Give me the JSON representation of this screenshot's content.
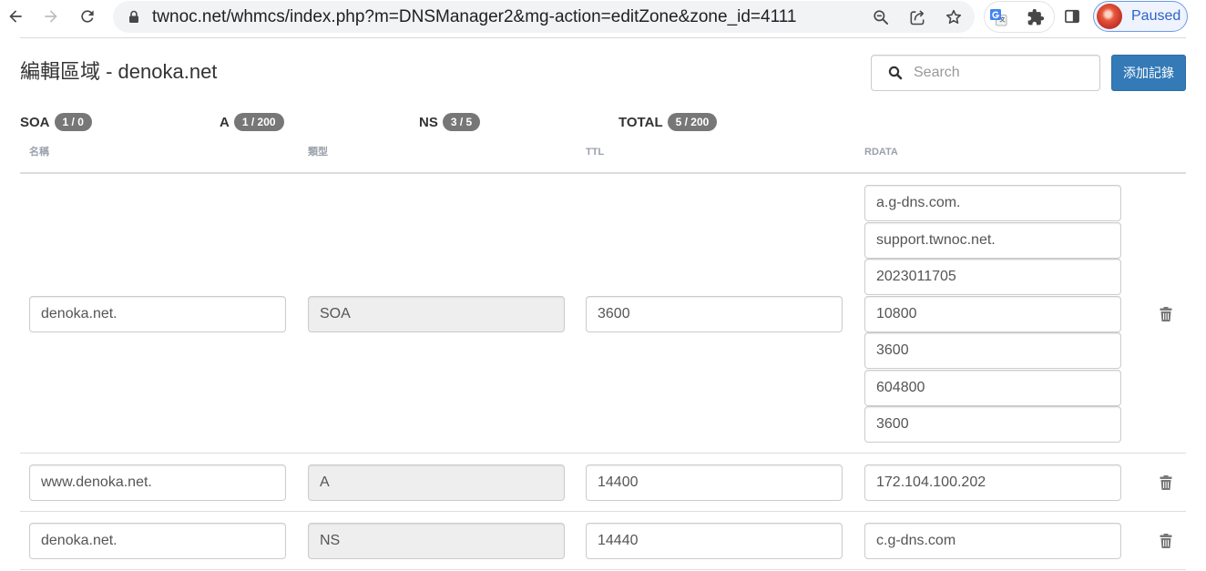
{
  "browser": {
    "url": "twnoc.net/whmcs/index.php?m=DNSManager2&mg-action=editZone&zone_id=4111",
    "profile_label": "Paused",
    "icons": [
      "back-arrow-icon",
      "forward-arrow-icon",
      "reload-icon",
      "lock-icon",
      "zoom-icon",
      "share-icon",
      "star-icon",
      "translate-icon",
      "extensions-puzzle-icon",
      "side-panel-icon"
    ]
  },
  "page": {
    "title": "編輯區域 - denoka.net",
    "search_placeholder": "Search",
    "search_icon": "search-icon",
    "add_record_label": "添加記錄",
    "accent_color": "#337ab7",
    "badge_color": "#777777"
  },
  "stats": [
    {
      "label": "SOA",
      "value": "1 / 0"
    },
    {
      "label": "A",
      "value": "1 / 200"
    },
    {
      "label": "NS",
      "value": "3 / 5"
    },
    {
      "label": "TOTAL",
      "value": "5 / 200"
    }
  ],
  "table": {
    "columns": [
      "名稱",
      "類型",
      "TTL",
      "RDATA"
    ],
    "row_action_icon": "trash-icon",
    "rows": [
      {
        "name": "denoka.net.",
        "type": "SOA",
        "ttl": "3600",
        "rdata": [
          "a.g-dns.com.",
          "support.twnoc.net.",
          "2023011705",
          "10800",
          "3600",
          "604800",
          "3600"
        ]
      },
      {
        "name": "www.denoka.net.",
        "type": "A",
        "ttl": "14400",
        "rdata": [
          "172.104.100.202"
        ]
      },
      {
        "name": "denoka.net.",
        "type": "NS",
        "ttl": "14440",
        "rdata": [
          "c.g-dns.com"
        ]
      }
    ]
  }
}
